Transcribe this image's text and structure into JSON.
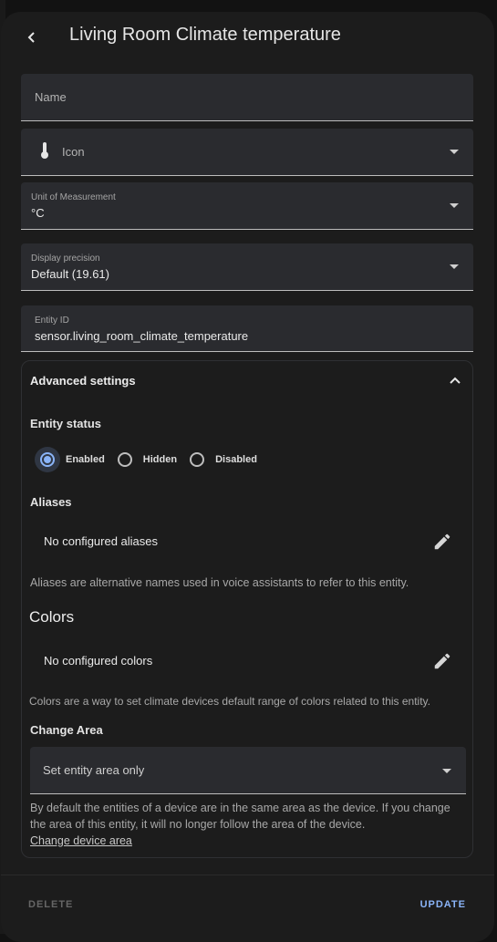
{
  "dialog": {
    "title": "Living Room Climate temperature"
  },
  "fields": {
    "name": {
      "label": "Name",
      "value": ""
    },
    "icon": {
      "label": "Icon",
      "icon": "thermometer-icon"
    },
    "unit": {
      "label": "Unit of Measurement",
      "value": "°C"
    },
    "precision": {
      "label": "Display precision",
      "value": "Default (19.61)"
    },
    "entity_id": {
      "label": "Entity ID",
      "value": "sensor.living_room_climate_temperature"
    }
  },
  "advanced": {
    "title": "Advanced settings",
    "entity_status": {
      "title": "Entity status",
      "options": [
        "Enabled",
        "Hidden",
        "Disabled"
      ],
      "selected": "Enabled"
    },
    "aliases": {
      "title": "Aliases",
      "empty_text": "No configured aliases",
      "helper": "Aliases are alternative names used in voice assistants to refer to this entity."
    },
    "colors": {
      "title": "Colors",
      "empty_text": "No configured colors",
      "helper": "Colors are a way to set climate devices default range of colors related to this entity."
    },
    "change_area": {
      "title": "Change Area",
      "select_value": "Set entity area only",
      "helper": "By default the entities of a device are in the same area as the device. If you change the area of this entity, it will no longer follow the area of the device.",
      "link": "Change device area"
    }
  },
  "footer": {
    "delete_label": "DELETE",
    "update_label": "UPDATE"
  },
  "colors": {
    "accent": "#8ab4f8",
    "background": "#1c1c1c",
    "field": "#2a2b2f"
  }
}
